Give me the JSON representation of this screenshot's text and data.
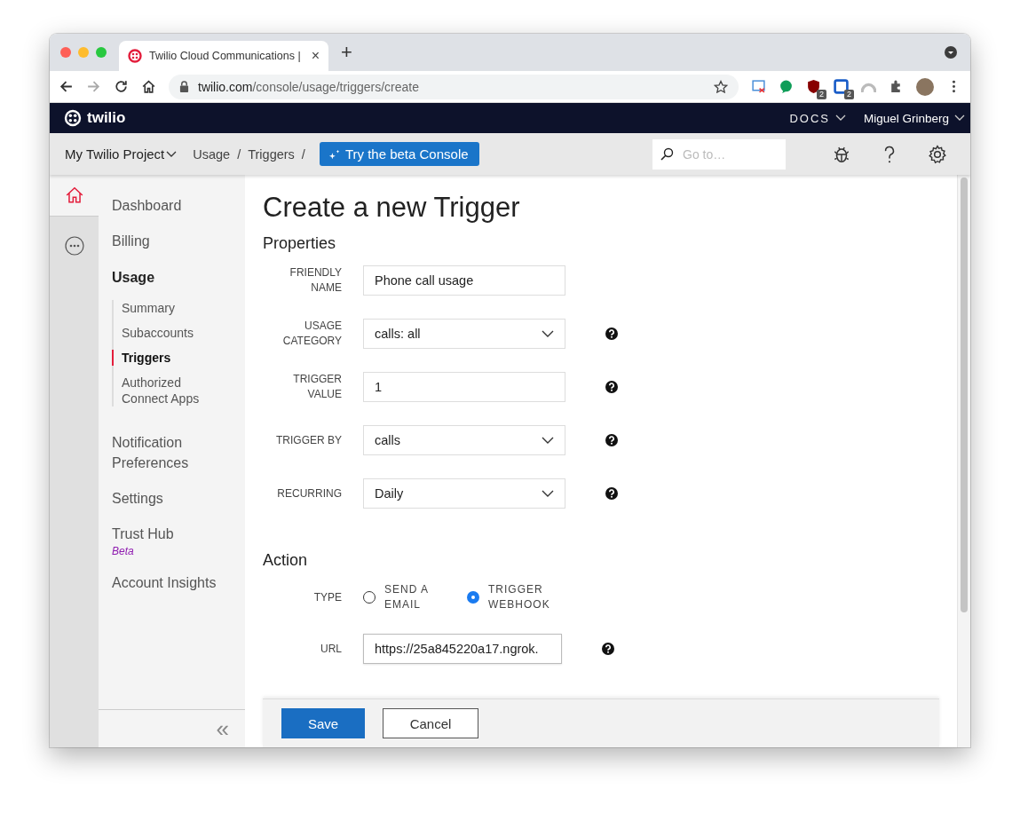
{
  "browser": {
    "tab_title": "Twilio Cloud Communications |",
    "tab_close": "×",
    "new_tab": "+",
    "url_host": "twilio.com",
    "url_path": "/console/usage/triggers/create",
    "extension_badges": [
      "2",
      "2"
    ]
  },
  "topnav": {
    "logo": "twilio",
    "docs": "DOCS",
    "user": "Miguel Grinberg"
  },
  "project_bar": {
    "project": "My Twilio Project",
    "breadcrumbs": [
      {
        "label": "Usage",
        "separator": "/"
      },
      {
        "label": "Triggers",
        "separator": "/"
      }
    ],
    "beta_button": "Try the beta Console",
    "search": {
      "placeholder": "Go to…"
    }
  },
  "sidebar": {
    "items": [
      {
        "label": "Dashboard",
        "selected": false
      },
      {
        "label": "Billing",
        "selected": false
      },
      {
        "label": "Usage",
        "selected": true,
        "children": [
          {
            "label": "Summary",
            "selected": false
          },
          {
            "label": "Subaccounts",
            "selected": false
          },
          {
            "label": "Triggers",
            "selected": true
          },
          {
            "label": "Authorized Connect Apps",
            "selected": false
          }
        ]
      },
      {
        "label": "Notification Preferences",
        "selected": false
      },
      {
        "label": "Settings",
        "selected": false
      },
      {
        "label": "Trust Hub",
        "selected": false,
        "badge": "Beta"
      },
      {
        "label": "Account Insights",
        "selected": false
      }
    ],
    "collapse": "«"
  },
  "page": {
    "title": "Create a new Trigger",
    "properties": {
      "heading": "Properties",
      "fields": [
        {
          "kind": "text",
          "label": "FRIENDLY NAME",
          "value": "Phone call usage",
          "help": false
        },
        {
          "kind": "select",
          "label": "USAGE CATEGORY",
          "value": "calls: all",
          "help": true
        },
        {
          "kind": "text",
          "label": "TRIGGER VALUE",
          "value": "1",
          "help": true
        },
        {
          "kind": "select",
          "label": "TRIGGER BY",
          "value": "calls",
          "help": true
        },
        {
          "kind": "select",
          "label": "RECURRING",
          "value": "Daily",
          "help": true
        }
      ]
    },
    "action": {
      "heading": "Action",
      "type_label": "TYPE",
      "options": [
        {
          "label": "SEND A EMAIL",
          "selected": false
        },
        {
          "label": "TRIGGER WEBHOOK",
          "selected": true
        }
      ],
      "url_label": "URL",
      "url_value": "https://25a845220a17.ngrok.",
      "url_help": true
    },
    "buttons": [
      {
        "kind": "primary",
        "label": "Save"
      },
      {
        "kind": "secondary",
        "label": "Cancel"
      }
    ]
  }
}
